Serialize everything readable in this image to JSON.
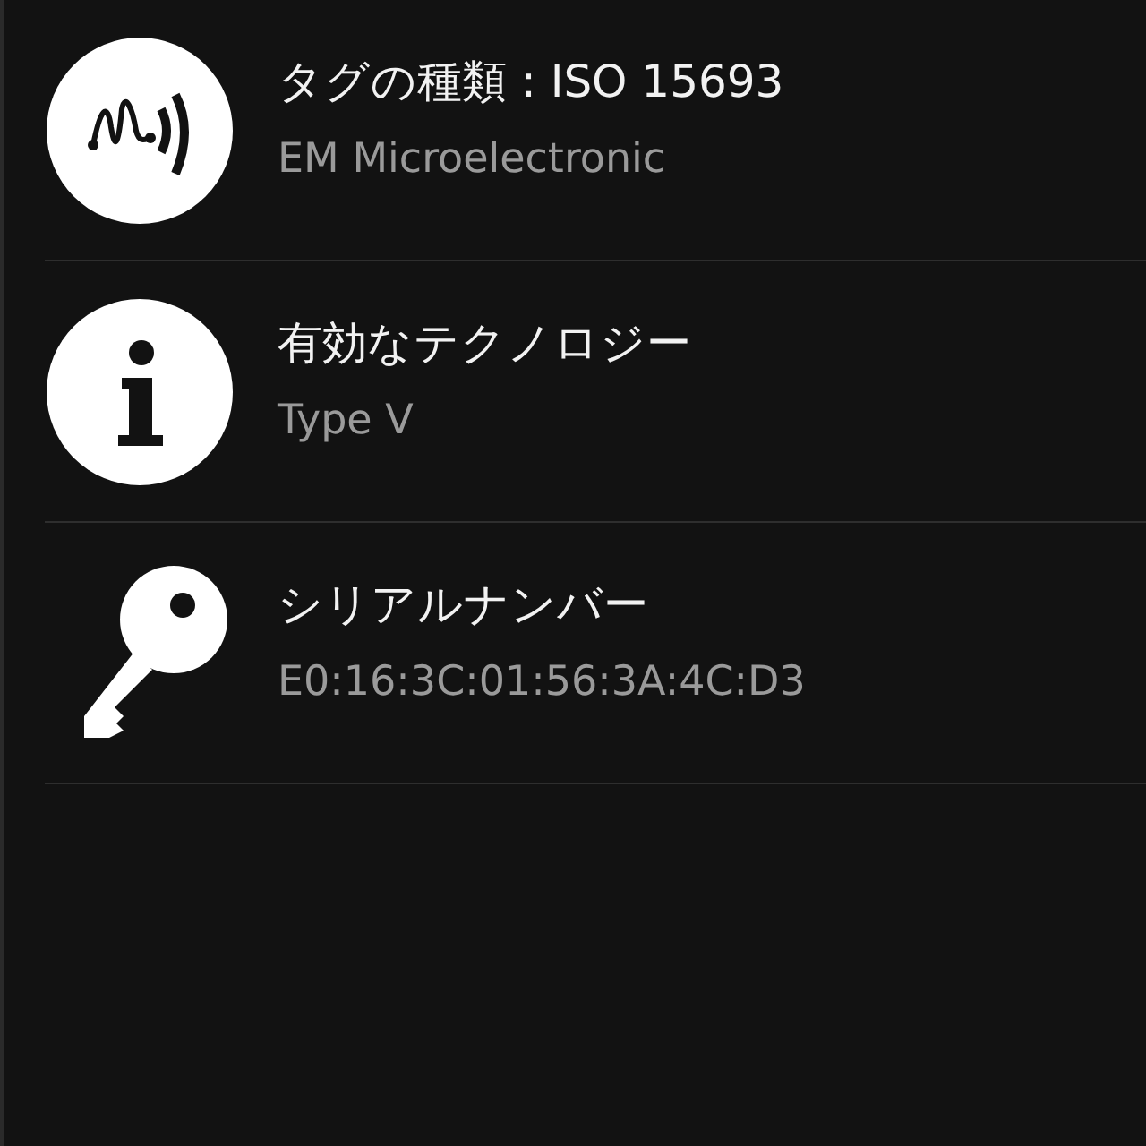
{
  "items": [
    {
      "kind": "tag",
      "title": "タグの種類 : ISO 15693",
      "value": "EM Microelectronic"
    },
    {
      "kind": "info",
      "title": "有効なテクノロジー",
      "value": "Type V"
    },
    {
      "kind": "key",
      "title": "シリアルナンバー",
      "value": "E0:16:3C:01:56:3A:4C:D3"
    }
  ]
}
